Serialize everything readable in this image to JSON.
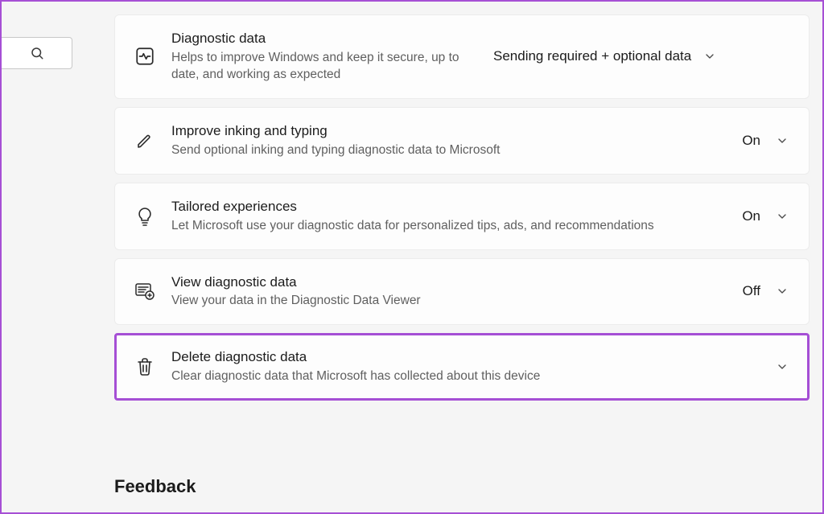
{
  "search": {
    "placeholder": ""
  },
  "cards": {
    "diagnostic": {
      "title": "Diagnostic data",
      "desc": "Helps to improve Windows and keep it secure, up to date, and working as expected",
      "status": "Sending required + optional data"
    },
    "inking": {
      "title": "Improve inking and typing",
      "desc": "Send optional inking and typing diagnostic data to Microsoft",
      "status": "On"
    },
    "tailored": {
      "title": "Tailored experiences",
      "desc": "Let Microsoft use your diagnostic data for personalized tips, ads, and recommendations",
      "status": "On"
    },
    "view": {
      "title": "View diagnostic data",
      "desc": "View your data in the Diagnostic Data Viewer",
      "status": "Off"
    },
    "delete": {
      "title": "Delete diagnostic data",
      "desc": "Clear diagnostic data that Microsoft has collected about this device"
    }
  },
  "section_heading": "Feedback"
}
